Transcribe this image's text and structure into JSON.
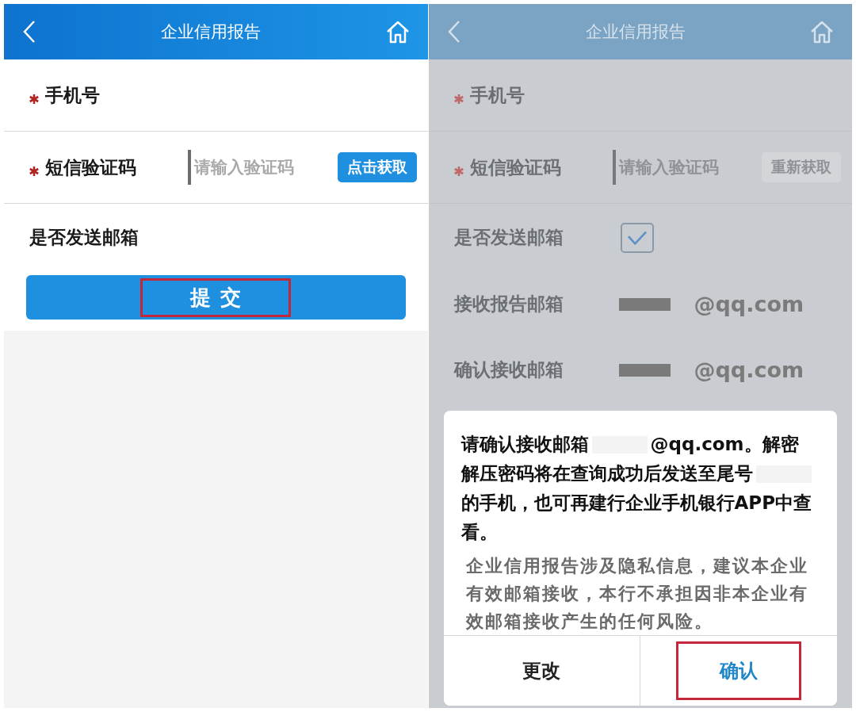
{
  "screens": [
    {
      "dimmed": false,
      "header": {
        "title": "企业信用报告"
      },
      "fields": [
        {
          "kind": "text",
          "label": "手机号",
          "required": true
        },
        {
          "kind": "code",
          "label": "短信验证码",
          "required": true,
          "placeholder": "请输入验证码",
          "button": {
            "label": "点击获取",
            "disabled": false
          }
        },
        {
          "kind": "plain",
          "label": "是否发送邮箱",
          "required": false
        }
      ],
      "submit": {
        "label": "提交",
        "highlighted": true
      }
    },
    {
      "dimmed": true,
      "header": {
        "title": "企业信用报告"
      },
      "fields": [
        {
          "kind": "text",
          "label": "手机号",
          "required": true
        },
        {
          "kind": "code",
          "label": "短信验证码",
          "required": true,
          "placeholder": "请输入验证码",
          "button": {
            "label": "重新获取",
            "disabled": true
          }
        },
        {
          "kind": "checkbox",
          "label": "是否发送邮箱",
          "required": false,
          "checked": true
        },
        {
          "kind": "email",
          "label": "接收报告邮箱",
          "required": false,
          "suffix": "@qq.com"
        },
        {
          "kind": "email",
          "label": "确认接收邮箱",
          "required": false,
          "suffix": "@qq.com"
        }
      ],
      "dialog": {
        "message": [
          [
            {
              "kind": "text",
              "text": "请确认接收邮箱"
            },
            {
              "kind": "redacted"
            },
            {
              "kind": "text",
              "text": "@qq.com。解密"
            }
          ],
          [
            {
              "kind": "text",
              "text": "解压密码将在查询成功后发送至尾号"
            },
            {
              "kind": "redacted"
            }
          ],
          [
            {
              "kind": "text",
              "text": "的手机，也可再建行企业手机银行APP中查看。"
            }
          ]
        ],
        "note": "企业信用报告涉及隐私信息，建议本企业有效邮箱接收，本行不承担因非本企业有效邮箱接收产生的任何风险。",
        "buttons": [
          {
            "label": "更改",
            "primary": false,
            "highlighted": false
          },
          {
            "label": "确认",
            "primary": true,
            "highlighted": true
          }
        ]
      }
    }
  ]
}
